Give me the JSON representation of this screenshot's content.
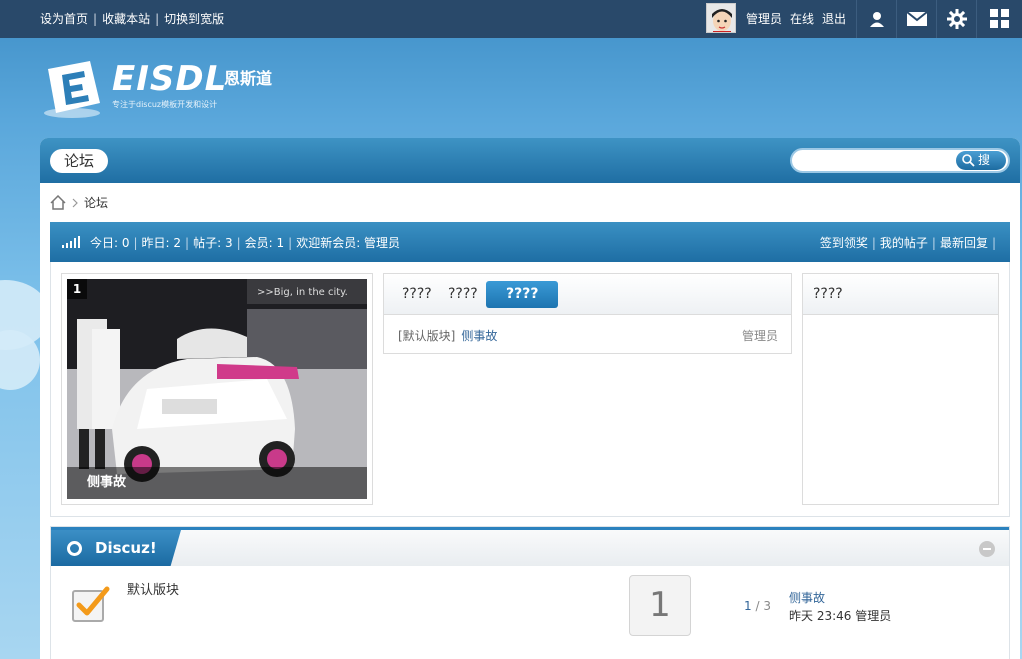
{
  "topbar": {
    "links": [
      "设为首页",
      "收藏本站",
      "切换到宽版"
    ],
    "username": "管理员",
    "status": "在线",
    "logout": "退出",
    "icons": [
      "user-icon",
      "mail-icon",
      "gear-icon",
      "grid-icon"
    ]
  },
  "logo": {
    "text": "EISDL",
    "cn": "恩斯道",
    "sub": "专注于discuz模板开发和设计"
  },
  "nav": {
    "tab": "论坛",
    "search_button": "搜"
  },
  "breadcrumb": {
    "current": "论坛"
  },
  "stats": {
    "today": "今日: 0",
    "yesterday": "昨日: 2",
    "posts": "帖子: 3",
    "members": "会员: 1",
    "newest": "欢迎新会员: 管理员",
    "links": [
      "签到领奖",
      "我的帖子",
      "最新回复"
    ]
  },
  "slide": {
    "number": "1",
    "caption": "侧事故"
  },
  "tabs_box": {
    "tabs": [
      "????",
      "????",
      "????"
    ],
    "active_index": 2,
    "row_prefix": "[默认版块]",
    "row_title": "侧事故",
    "row_author": "管理员"
  },
  "side_box": {
    "title": "????"
  },
  "category": {
    "title": "Discuz!",
    "forum_name": "默认版块",
    "today_count": "1",
    "threads": "1",
    "posts": "3",
    "last_title": "侧事故",
    "last_time": "昨天 23:46",
    "last_author": "管理员"
  }
}
